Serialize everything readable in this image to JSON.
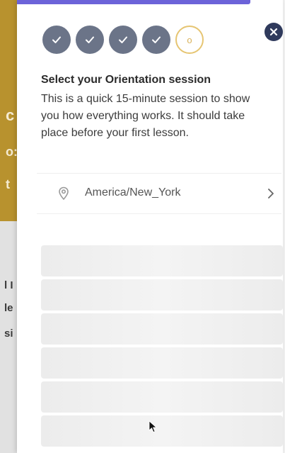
{
  "background": {
    "fragments": [
      "c",
      "o:",
      "t",
      "l I",
      "le",
      "si"
    ]
  },
  "progress": {
    "steps": [
      {
        "state": "completed",
        "icon": "check-icon"
      },
      {
        "state": "completed",
        "icon": "check-icon"
      },
      {
        "state": "completed",
        "icon": "check-icon"
      },
      {
        "state": "completed",
        "icon": "check-icon"
      },
      {
        "state": "current",
        "label": "o"
      }
    ]
  },
  "modal": {
    "title": "Select your Orientation session",
    "description": "This is a quick 15-minute session to show you how everything works. It should take place before your first lesson.",
    "timezone": {
      "value": "America/New_York",
      "icon": "location-pin-icon",
      "chevron": "chevron-right-icon"
    },
    "slots_loading_count": 6,
    "close_icon": "close-icon"
  },
  "colors": {
    "accent_bar": "#6c63d9",
    "step_done": "#6b7488",
    "step_current_border": "#e6c572",
    "close_button": "#2f3a5c",
    "background_gold": "#b8922e"
  }
}
